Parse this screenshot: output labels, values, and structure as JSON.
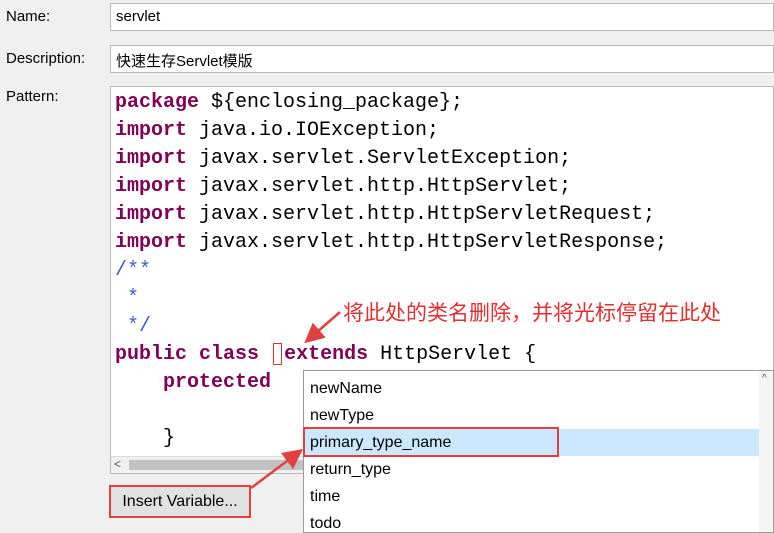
{
  "form": {
    "name_label": "Name:",
    "name_value": "servlet",
    "description_label": "Description:",
    "description_value": "快速生存Servlet模版",
    "pattern_label": "Pattern:"
  },
  "pattern_code": {
    "line1_kw": "package",
    "line1_rest": " ${enclosing_package};",
    "import_kw": "import",
    "imports": [
      " java.io.IOException;",
      " javax.servlet.ServletException;",
      " javax.servlet.http.HttpServlet;",
      " javax.servlet.http.HttpServletRequest;",
      " javax.servlet.http.HttpServletResponse;"
    ],
    "comment_open": "/**",
    "comment_mid": " *",
    "comment_close": " */",
    "public_kw": "public",
    "class_kw": "class",
    "extends_kw": "extends",
    "superclass": " HttpServlet {",
    "protected_kw": "protected",
    "closing_brace": "}"
  },
  "insert_button_label": "Insert Variable...",
  "annotation_text": "将此处的类名删除，并将光标停留在此处",
  "variable_popup": {
    "items": [
      "newName",
      "newType",
      "primary_type_name",
      "return_type",
      "time",
      "todo"
    ],
    "selected": "primary_type_name"
  },
  "colors": {
    "keyword": "#7f0055",
    "comment": "#3f5fbf",
    "highlight_red": "#e04040",
    "selection": "#cce8ff"
  },
  "icons": [
    "scroll-left-arrow-icon",
    "scroll-up-arrow-icon",
    "annotation-arrow-icon"
  ]
}
